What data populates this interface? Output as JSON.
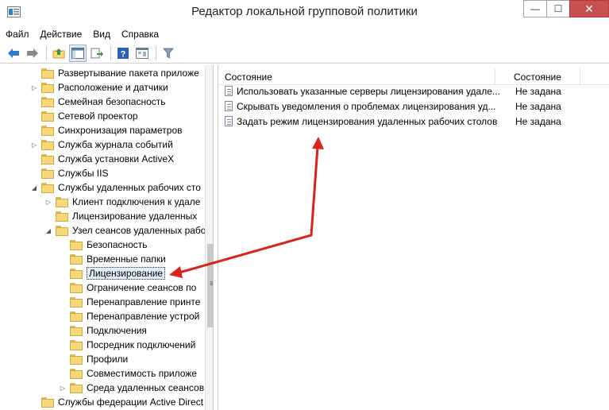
{
  "window": {
    "title": "Редактор локальной групповой политики",
    "buttons": {
      "minimize": "—",
      "maximize": "☐",
      "close": "✕"
    }
  },
  "menu": [
    "Файл",
    "Действие",
    "Вид",
    "Справка"
  ],
  "tree": {
    "items": [
      {
        "label": "Развертывание пакета приложе",
        "expander": ""
      },
      {
        "label": "Расположение и датчики",
        "expander": "▷"
      },
      {
        "label": "Семейная безопасность",
        "expander": ""
      },
      {
        "label": "Сетевой проектор",
        "expander": ""
      },
      {
        "label": "Синхронизация параметров",
        "expander": ""
      },
      {
        "label": "Служба журнала событий",
        "expander": "▷"
      },
      {
        "label": "Служба установки ActiveX",
        "expander": ""
      },
      {
        "label": "Службы IIS",
        "expander": ""
      },
      {
        "label": "Службы удаленных рабочих сто",
        "expander": "◢"
      },
      {
        "label": "Клиент подключения к удале",
        "expander": "▷"
      },
      {
        "label": "Лицензирование удаленных",
        "expander": ""
      },
      {
        "label": "Узел сеансов удаленных рабо",
        "expander": "◢"
      },
      {
        "label": "Безопасность",
        "expander": ""
      },
      {
        "label": "Временные папки",
        "expander": ""
      },
      {
        "label": "Лицензирование",
        "expander": "",
        "selected": true
      },
      {
        "label": "Ограничение сеансов по",
        "expander": ""
      },
      {
        "label": "Перенаправление принте",
        "expander": ""
      },
      {
        "label": "Перенаправление устрой",
        "expander": ""
      },
      {
        "label": "Подключения",
        "expander": ""
      },
      {
        "label": "Посредник подключений",
        "expander": ""
      },
      {
        "label": "Профили",
        "expander": ""
      },
      {
        "label": "Совместимость приложе",
        "expander": ""
      },
      {
        "label": "Среда удаленных сеансов",
        "expander": "▷"
      },
      {
        "label": "Службы федерации Active Direct",
        "expander": ""
      }
    ],
    "scroll_grip": "≡"
  },
  "list": {
    "columns": [
      "Состояние",
      "Состояние"
    ],
    "rows": [
      {
        "name": "Использовать указанные серверы лицензирования удале...",
        "state": "Не задана"
      },
      {
        "name": "Скрывать уведомления о проблемах лицензирования уд...",
        "state": "Не задана"
      },
      {
        "name": "Задать режим лицензирования удаленных рабочих столов",
        "state": "Не задана"
      }
    ]
  },
  "colors": {
    "annotation_arrow": "#d9231c",
    "folder": "#f6d77a",
    "close_button": "#c75050"
  }
}
